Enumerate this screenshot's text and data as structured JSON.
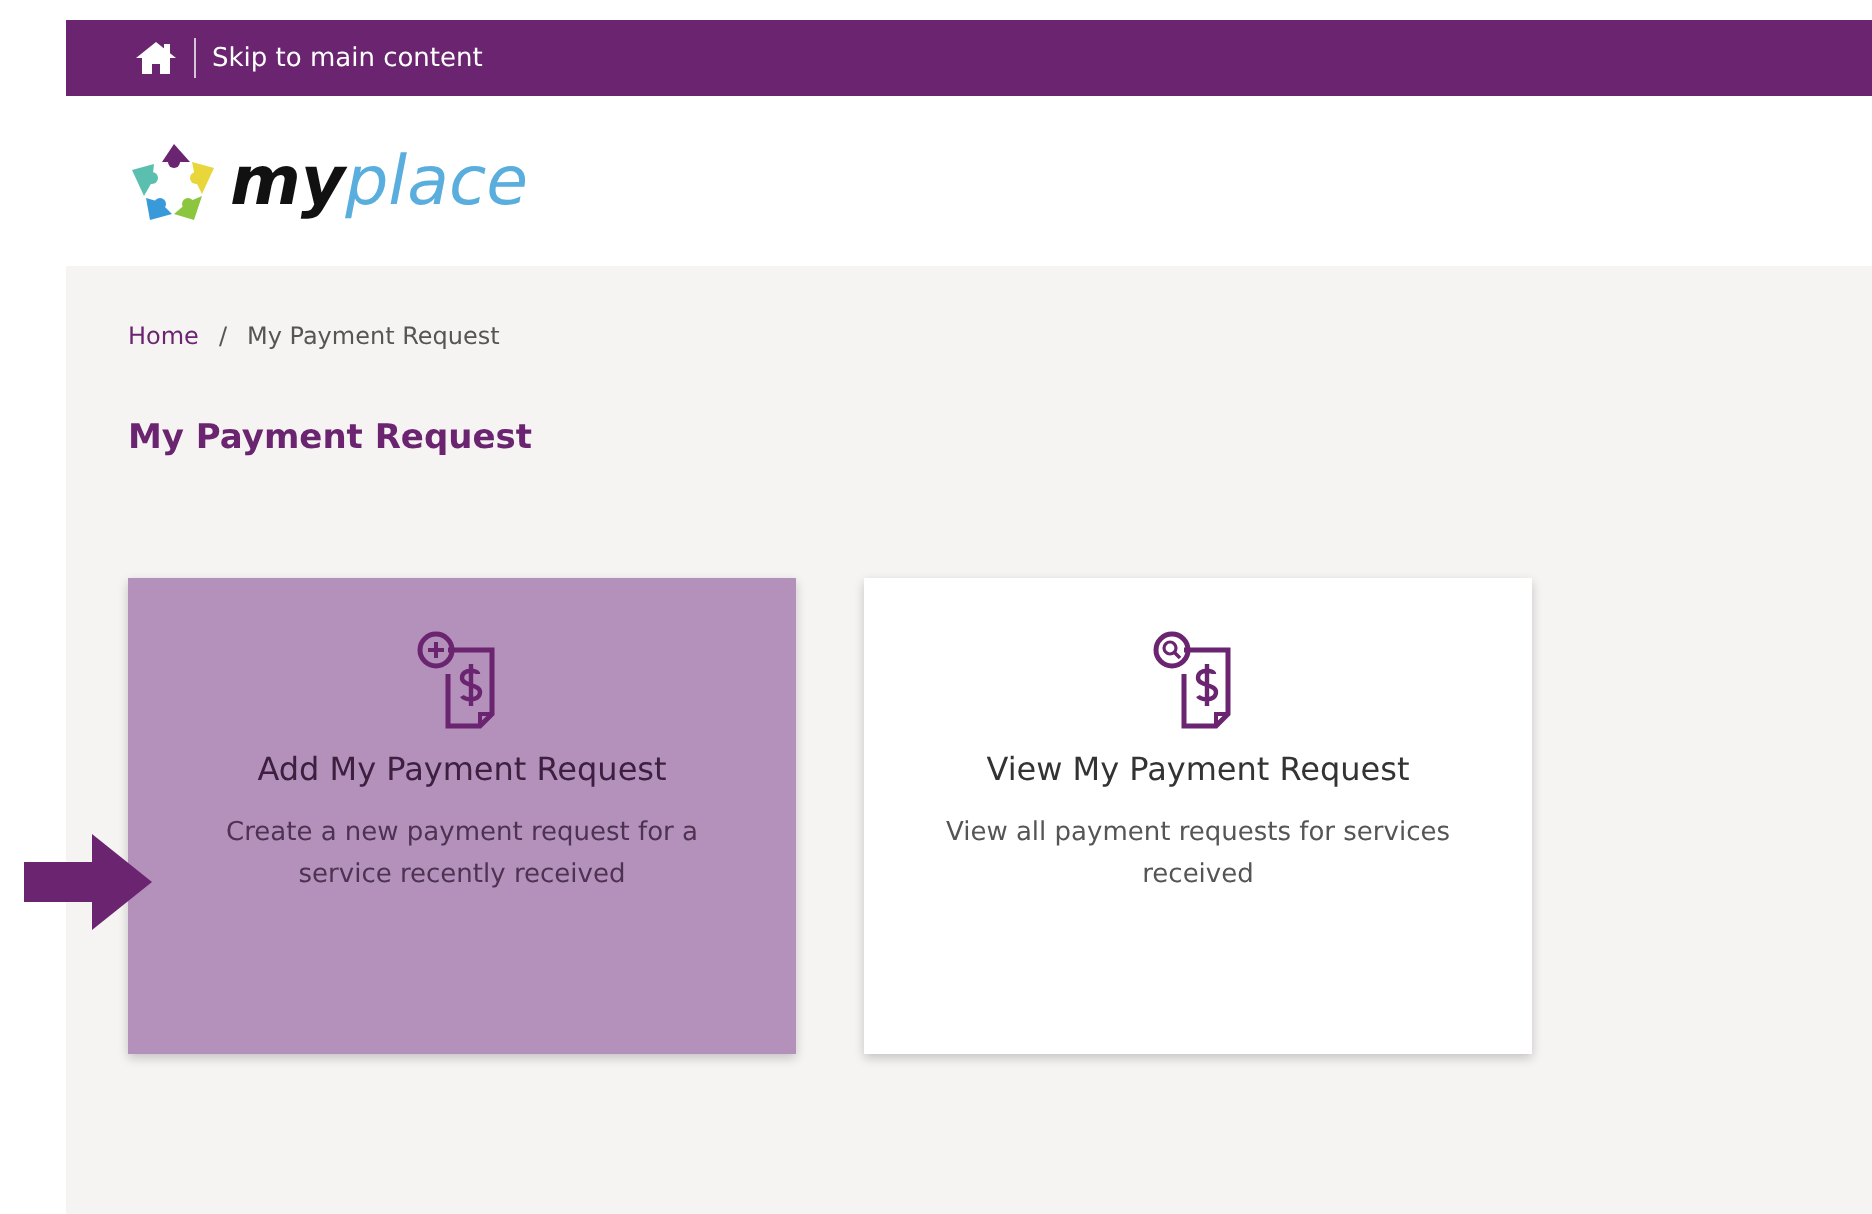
{
  "top_bar": {
    "skip_link": "Skip to main content"
  },
  "logo": {
    "parts": [
      "my",
      "place"
    ]
  },
  "breadcrumb": [
    {
      "label": "Home",
      "link": true
    },
    {
      "label": "My Payment Request",
      "link": false
    }
  ],
  "breadcrumb_separator": "/",
  "page_title": "My Payment Request",
  "cards": [
    {
      "kind": "add",
      "title": "Add My Payment Request",
      "description": "Create a new payment request for a service recently received",
      "selected": true
    },
    {
      "kind": "view",
      "title": "View My Payment Request",
      "description": "View all payment requests for services received",
      "selected": false
    }
  ]
}
